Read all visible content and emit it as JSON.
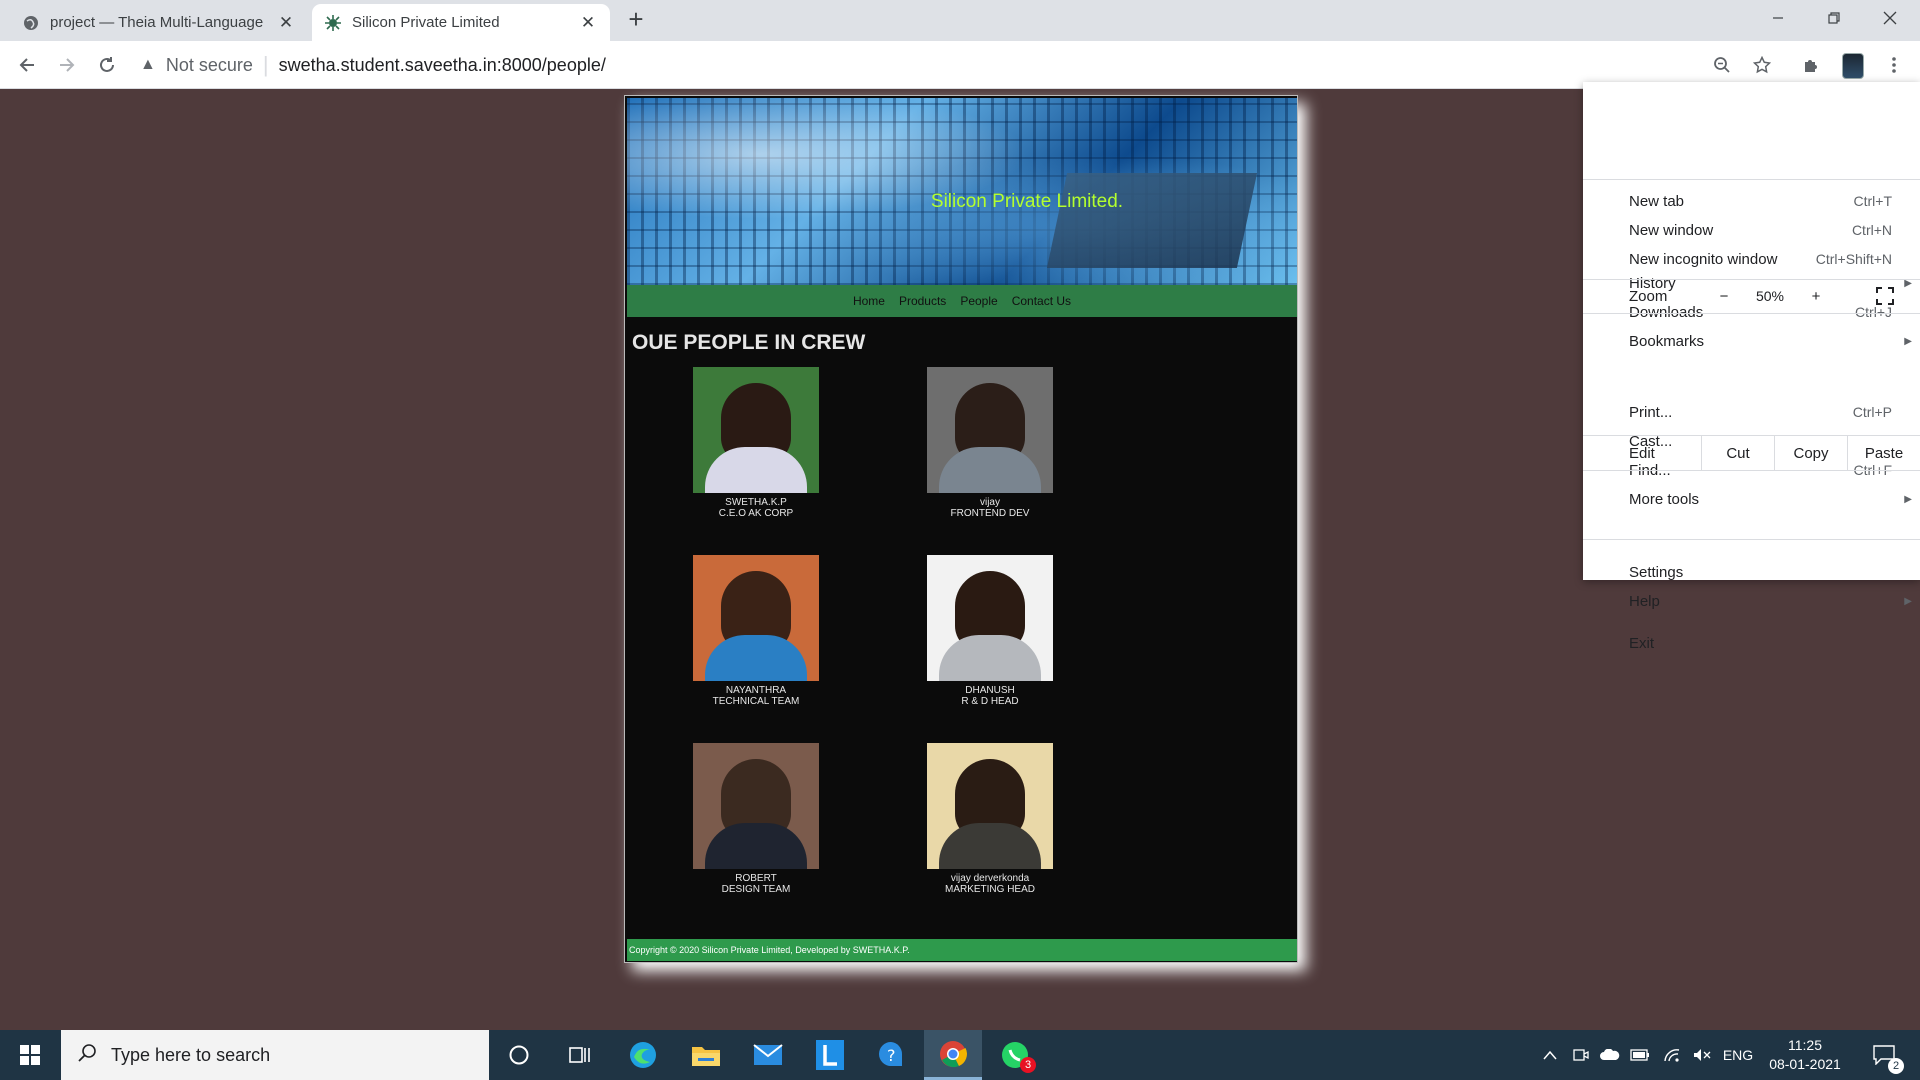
{
  "tabs": [
    {
      "title": "project — Theia Multi-Language",
      "icon": "globe-icon"
    },
    {
      "title": "Silicon Private Limited",
      "icon": "django-bug-icon"
    }
  ],
  "toolbar": {
    "security_label": "Not secure",
    "url": "swetha.student.saveetha.in:8000/people/"
  },
  "site": {
    "banner_title": "Silicon Private Limited.",
    "nav": [
      "Home",
      "Products",
      "People",
      "Contact Us"
    ],
    "heading": "OUE PEOPLE IN CREW",
    "people": [
      {
        "name": "SWETHA.K.P",
        "role": "C.E.O AK CORP"
      },
      {
        "name": "vijay",
        "role": "FRONTEND DEV"
      },
      {
        "name": "NAYANTHRA",
        "role": "TECHNICAL TEAM"
      },
      {
        "name": "DHANUSH",
        "role": "R & D HEAD"
      },
      {
        "name": "ROBERT",
        "role": "DESIGN TEAM"
      },
      {
        "name": "vijay derverkonda",
        "role": "MARKETING HEAD"
      }
    ],
    "footer": "Copyright © 2020 Silicon Private Limited, Developed by SWETHA.K.P."
  },
  "menu": {
    "new_tab": {
      "label": "New tab",
      "shortcut": "Ctrl+T"
    },
    "new_window": {
      "label": "New window",
      "shortcut": "Ctrl+N"
    },
    "new_incognito": {
      "label": "New incognito window",
      "shortcut": "Ctrl+Shift+N"
    },
    "history": {
      "label": "History"
    },
    "downloads": {
      "label": "Downloads",
      "shortcut": "Ctrl+J"
    },
    "bookmarks": {
      "label": "Bookmarks"
    },
    "zoom": {
      "label": "Zoom",
      "minus": "−",
      "value": "50%",
      "plus": "+"
    },
    "print": {
      "label": "Print...",
      "shortcut": "Ctrl+P"
    },
    "cast": {
      "label": "Cast..."
    },
    "find": {
      "label": "Find...",
      "shortcut": "Ctrl+F"
    },
    "more_tools": {
      "label": "More tools"
    },
    "edit": {
      "label": "Edit",
      "cut": "Cut",
      "copy": "Copy",
      "paste": "Paste"
    },
    "settings": {
      "label": "Settings"
    },
    "help": {
      "label": "Help"
    },
    "exit": {
      "label": "Exit"
    }
  },
  "taskbar": {
    "search_placeholder": "Type here to search",
    "language": "ENG",
    "time": "11:25",
    "date": "08-01-2021",
    "whatsapp_badge": "3",
    "notification_badge": "2"
  }
}
